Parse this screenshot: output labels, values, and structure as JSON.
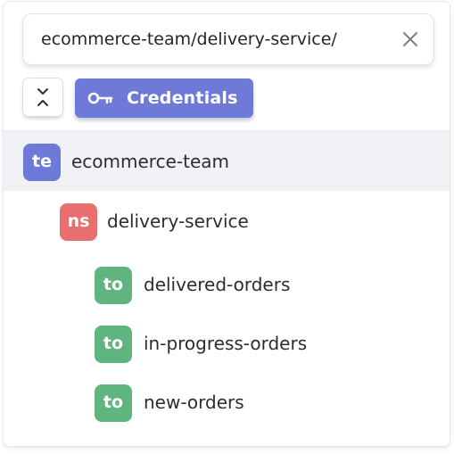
{
  "search": {
    "value": "ecommerce-team/delivery-service/",
    "clear_icon": "close-icon"
  },
  "toolbar": {
    "collapse_icon": "collapse-chevrons-icon",
    "credentials_label": "Credentials",
    "credentials_icon": "key-icon",
    "credentials_color": "#6f79d8"
  },
  "tree": {
    "team": {
      "badge": "te",
      "label": "ecommerce-team",
      "color": "#6f79d8"
    },
    "namespace": {
      "badge": "ns",
      "label": "delivery-service",
      "color": "#e96e6e"
    },
    "topics": [
      {
        "badge": "to",
        "label": "delivered-orders",
        "color": "#5fb47f"
      },
      {
        "badge": "to",
        "label": "in-progress-orders",
        "color": "#5fb47f"
      },
      {
        "badge": "to",
        "label": "new-orders",
        "color": "#5fb47f"
      }
    ]
  }
}
